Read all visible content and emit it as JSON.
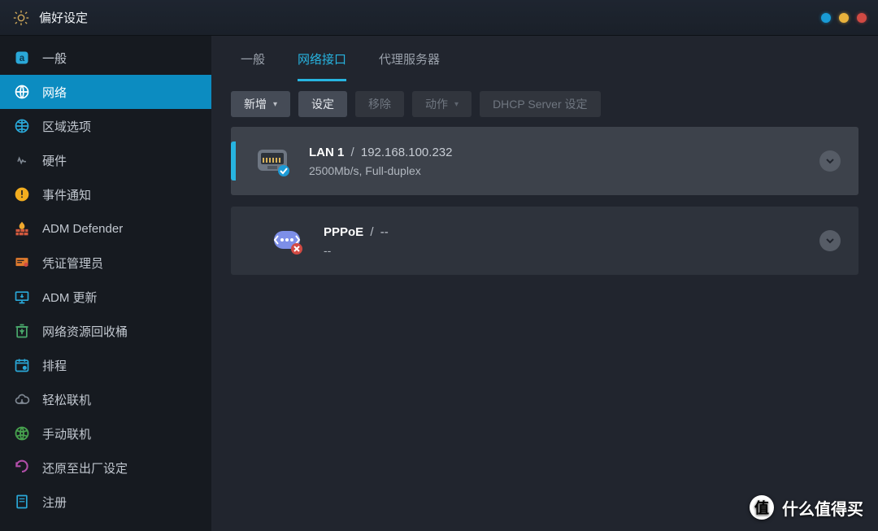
{
  "window": {
    "title": "偏好设定"
  },
  "sidebar": {
    "items": [
      {
        "label": "一般",
        "icon": "general-icon",
        "color": "#2aa8d8",
        "active": false
      },
      {
        "label": "网络",
        "icon": "network-icon",
        "color": "#ffffff",
        "active": true
      },
      {
        "label": "区域选项",
        "icon": "region-icon",
        "color": "#2aa8d8",
        "active": false
      },
      {
        "label": "硬件",
        "icon": "hardware-icon",
        "color": "#7f8893",
        "active": false
      },
      {
        "label": "事件通知",
        "icon": "alert-icon",
        "color": "#f2ad1f",
        "active": false
      },
      {
        "label": "ADM Defender",
        "icon": "firewall-icon",
        "color": "#d45a3e",
        "active": false
      },
      {
        "label": "凭证管理员",
        "icon": "certificate-icon",
        "color": "#e07b2e",
        "active": false
      },
      {
        "label": "ADM 更新",
        "icon": "update-icon",
        "color": "#2aa8d8",
        "active": false
      },
      {
        "label": "网络资源回收桶",
        "icon": "recycle-icon",
        "color": "#4aa96c",
        "active": false
      },
      {
        "label": "排程",
        "icon": "schedule-icon",
        "color": "#2aa8d8",
        "active": false
      },
      {
        "label": "轻松联机",
        "icon": "cloud-icon",
        "color": "#7f8893",
        "active": false
      },
      {
        "label": "手动联机",
        "icon": "manual-connect-icon",
        "color": "#47a24e",
        "active": false
      },
      {
        "label": "还原至出厂设定",
        "icon": "factory-reset-icon",
        "color": "#b14ea8",
        "active": false
      },
      {
        "label": "注册",
        "icon": "register-icon",
        "color": "#2aa8d8",
        "active": false
      }
    ]
  },
  "tabs": {
    "items": [
      {
        "label": "一般",
        "active": false
      },
      {
        "label": "网络接口",
        "active": true
      },
      {
        "label": "代理服务器",
        "active": false
      }
    ]
  },
  "toolbar": {
    "add": {
      "label": "新增",
      "hasCaret": true,
      "disabled": false
    },
    "config": {
      "label": "设定",
      "hasCaret": false,
      "disabled": false
    },
    "remove": {
      "label": "移除",
      "hasCaret": false,
      "disabled": true
    },
    "action": {
      "label": "动作",
      "hasCaret": true,
      "disabled": true
    },
    "dhcp": {
      "label": "DHCP Server 设定",
      "hasCaret": false,
      "disabled": true
    }
  },
  "interfaces": [
    {
      "name": "LAN 1",
      "sep": "/",
      "address": "192.168.100.232",
      "status": "2500Mb/s, Full-duplex",
      "iconType": "ethernet",
      "badge": "ok",
      "selected": true
    },
    {
      "name": "PPPoE",
      "sep": "/",
      "address": "--",
      "status": "--",
      "iconType": "pppoe",
      "badge": "error",
      "selected": false
    }
  ],
  "watermark": {
    "text": "什么值得买",
    "badge": "值"
  }
}
